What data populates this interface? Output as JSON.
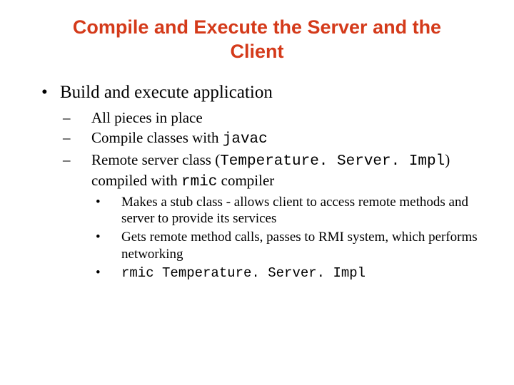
{
  "title": "Compile and Execute the Server and the Client",
  "lvl1_text": "Build and execute application",
  "lvl2_a": "All pieces in place",
  "lvl2_b_pre": "Compile classes with ",
  "lvl2_b_code": "javac",
  "lvl2_c_pre": "Remote server class (",
  "lvl2_c_code": "Temperature. Server. Impl",
  "lvl2_c_mid": ") compiled with ",
  "lvl2_c_code2": "rmic",
  "lvl2_c_post": " compiler",
  "lvl3_a": "Makes a stub class - allows client to access remote methods and server to provide its services",
  "lvl3_b": "Gets remote method calls, passes to RMI system, which performs networking",
  "lvl3_c_code": "rmic Temperature. Server. Impl",
  "glyphs": {
    "bullet": "•",
    "dash": "–",
    "dot": "•"
  }
}
